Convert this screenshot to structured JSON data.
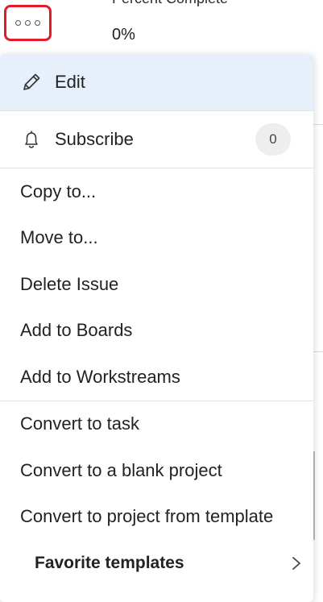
{
  "background": {
    "field_label": "Percent Complete",
    "field_value": "0%"
  },
  "more_button": {
    "icon": "more-horizontal-icon",
    "highlight_color": "#e11d2a"
  },
  "menu": {
    "edit": {
      "label": "Edit",
      "icon": "pencil-icon"
    },
    "subscribe": {
      "label": "Subscribe",
      "icon": "bell-icon",
      "count": "0"
    },
    "items_group1": [
      "Copy to...",
      "Move to...",
      "Delete Issue",
      "Add to Boards",
      "Add to Workstreams"
    ],
    "items_group2": [
      "Convert to task",
      "Convert to a blank project",
      "Convert to project from template"
    ],
    "favorite_templates": {
      "label": "Favorite templates",
      "icon": "chevron-right-icon"
    }
  },
  "colors": {
    "edit_highlight": "#e6effa",
    "badge_bg": "#eeeeee"
  }
}
